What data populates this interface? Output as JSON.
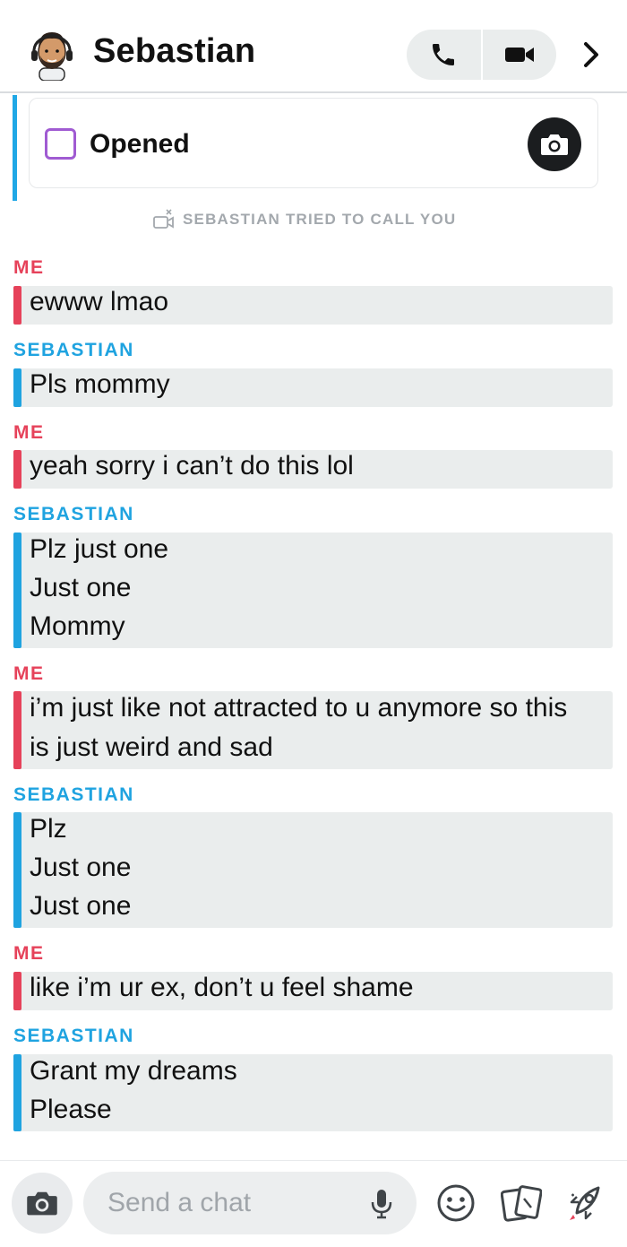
{
  "header": {
    "contact_name": "Sebastian",
    "avatar_icon": "bitmoji-avatar-icon",
    "call_icon": "phone-icon",
    "video_icon": "video-camera-icon",
    "more_icon": "chevron-right-icon"
  },
  "opened_card": {
    "label": "Opened",
    "status_color": "#a05bd2",
    "camera_icon": "camera-icon"
  },
  "missed_call": {
    "text": "SEBASTIAN TRIED TO CALL YOU",
    "icon": "missed-video-call-icon"
  },
  "colors": {
    "me_accent": "#e6425a",
    "sebastian_accent": "#1fa3e0",
    "bubble_bg": "#eaeded"
  },
  "messages": [
    {
      "sender": "ME",
      "from": "me",
      "lines": [
        "ewww lmao"
      ]
    },
    {
      "sender": "SEBASTIAN",
      "from": "sebastian",
      "lines": [
        "Pls mommy"
      ]
    },
    {
      "sender": "ME",
      "from": "me",
      "lines": [
        "yeah sorry i can’t do this lol"
      ]
    },
    {
      "sender": "SEBASTIAN",
      "from": "sebastian",
      "lines": [
        "Plz just one",
        "Just one",
        "Mommy"
      ]
    },
    {
      "sender": "ME",
      "from": "me",
      "lines": [
        "i’m just like not attracted to u anymore so this",
        "is just weird and sad"
      ]
    },
    {
      "sender": "SEBASTIAN",
      "from": "sebastian",
      "lines": [
        "Plz",
        "Just one",
        "Just one"
      ]
    },
    {
      "sender": "ME",
      "from": "me",
      "lines": [
        "like i’m ur ex, don’t u feel shame"
      ]
    },
    {
      "sender": "SEBASTIAN",
      "from": "sebastian",
      "lines": [
        "Grant my dreams",
        "Please"
      ]
    }
  ],
  "composer": {
    "placeholder": "Send a chat",
    "camera_icon": "camera-icon",
    "mic_icon": "microphone-icon",
    "emoji_icon": "smiley-icon",
    "stickers_icon": "cards-icon",
    "games_icon": "rocket-icon"
  }
}
